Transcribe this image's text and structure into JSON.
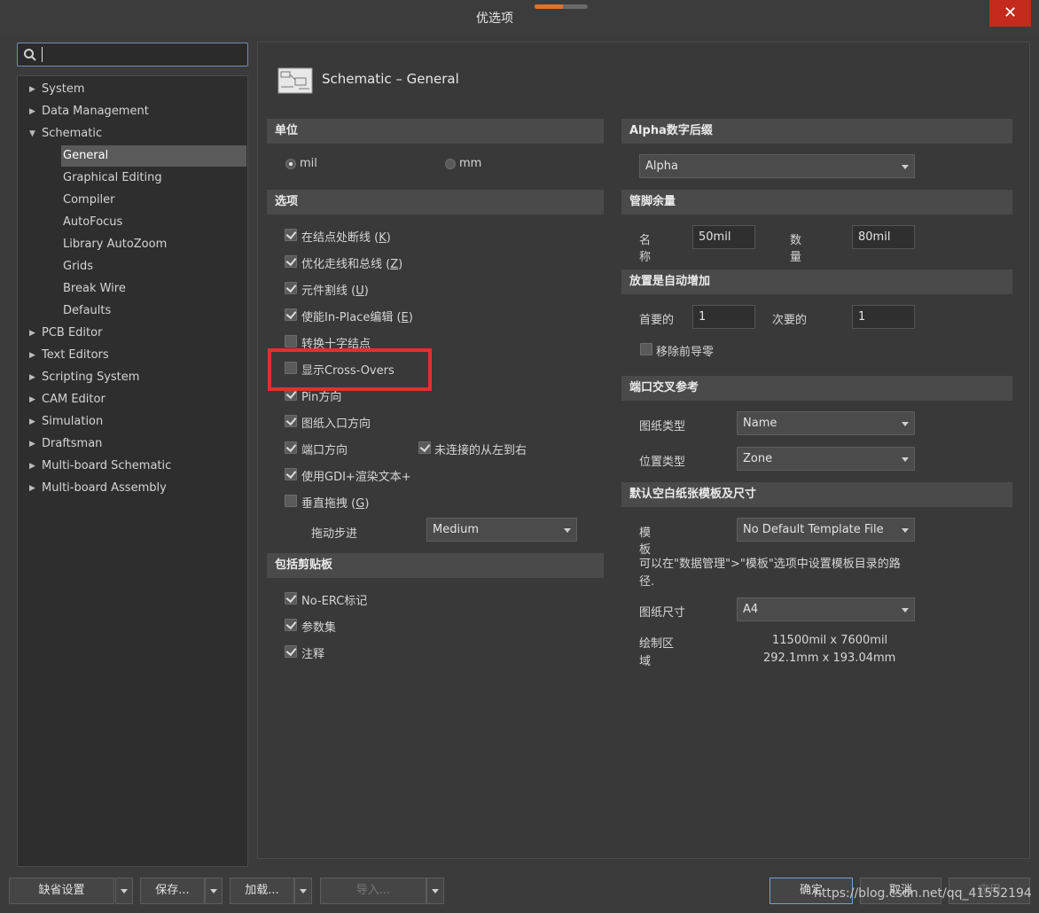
{
  "window": {
    "title": "优选项",
    "close_label": "✕"
  },
  "search": {
    "value": ""
  },
  "tree": {
    "items": [
      {
        "label": "System",
        "expanded": false
      },
      {
        "label": "Data Management",
        "expanded": false
      },
      {
        "label": "Schematic",
        "expanded": true
      },
      {
        "label": "General",
        "selected": true
      },
      {
        "label": "Graphical Editing"
      },
      {
        "label": "Compiler"
      },
      {
        "label": "AutoFocus"
      },
      {
        "label": "Library AutoZoom"
      },
      {
        "label": "Grids"
      },
      {
        "label": "Break Wire"
      },
      {
        "label": "Defaults"
      },
      {
        "label": "PCB Editor",
        "expanded": false
      },
      {
        "label": "Text Editors",
        "expanded": false
      },
      {
        "label": "Scripting System",
        "expanded": false
      },
      {
        "label": "CAM Editor",
        "expanded": false
      },
      {
        "label": "Simulation",
        "expanded": false
      },
      {
        "label": "Draftsman",
        "expanded": false
      },
      {
        "label": "Multi-board Schematic",
        "expanded": false
      },
      {
        "label": "Multi-board Assembly",
        "expanded": false
      }
    ]
  },
  "page": {
    "title": "Schematic – General"
  },
  "units": {
    "header": "单位",
    "mil_label": "mil",
    "mm_label": "mm",
    "selected": "mil"
  },
  "options": {
    "header": "选项",
    "items": [
      {
        "label": "在结点处断线",
        "key": "K",
        "checked": true
      },
      {
        "label": "优化走线和总线",
        "key": "Z",
        "checked": true
      },
      {
        "label": "元件割线",
        "key": "U",
        "checked": true
      },
      {
        "label": "使能In-Place编辑",
        "key": "E",
        "checked": true
      },
      {
        "label": "转换十字结点",
        "key": "",
        "checked": false
      },
      {
        "label": "显示Cross-Overs",
        "key": "",
        "checked": false
      },
      {
        "label": "Pin方向",
        "key": "",
        "checked": true
      },
      {
        "label": "图纸入口方向",
        "key": "",
        "checked": true
      },
      {
        "label": "端口方向",
        "key": "",
        "checked": true
      },
      {
        "label": "使用GDI+渲染文本+",
        "key": "",
        "checked": true
      },
      {
        "label": "垂直拖拽",
        "key": "G",
        "checked": false
      }
    ],
    "unconnected_label": "未连接的从左到右",
    "unconnected_checked": true,
    "drag_step_label": "拖动步进",
    "drag_step_value": "Medium"
  },
  "clipboard": {
    "header": "包括剪贴板",
    "items": [
      {
        "label": "No-ERC标记",
        "checked": true
      },
      {
        "label": "参数集",
        "checked": true
      },
      {
        "label": "注释",
        "checked": true
      }
    ]
  },
  "alpha": {
    "header": "Alpha数字后缀",
    "value": "Alpha"
  },
  "pin_margin": {
    "header": "管脚余量",
    "name_label_1": "名",
    "name_label_2": "称",
    "name_value": "50mil",
    "number_label_1": "数",
    "number_label_2": "量",
    "number_value": "80mil"
  },
  "auto_increment": {
    "header": "放置是自动增加",
    "primary_label": "首要的",
    "primary_value": "1",
    "secondary_label": "次要的",
    "secondary_value": "1",
    "remove_zeros_label": "移除前导零",
    "remove_zeros_checked": false
  },
  "port_cross_ref": {
    "header": "端口交叉参考",
    "sheet_type_label": "图纸类型",
    "sheet_type_value": "Name",
    "location_type_label": "位置类型",
    "location_type_value": "Zone"
  },
  "default_sheet": {
    "header": "默认空白纸张模板及尺寸",
    "template_label_1": "模",
    "template_label_2": "板",
    "template_value": "No Default Template File",
    "hint_1": "可以在\"数据管理\">\"模板\"选项中设置模板目录的路",
    "hint_2": "径.",
    "size_label": "图纸尺寸",
    "size_value": "A4",
    "area_label_1": "绘制区",
    "area_label_2": "域",
    "area_mil": "11500mil x 7600mil",
    "area_mm": "292.1mm x 193.04mm"
  },
  "footer": {
    "default_btn": "缺省设置",
    "save_btn": "保存...",
    "load_btn": "加载...",
    "import_btn": "导入...",
    "ok_btn": "确定",
    "cancel_btn": "取消",
    "apply_btn": "应用",
    "watermark": "https://blog.csdn.net/qq_41552194"
  },
  "colors": {
    "highlight": "#e03131",
    "close": "#c42b1c",
    "accent": "#e0732c"
  }
}
